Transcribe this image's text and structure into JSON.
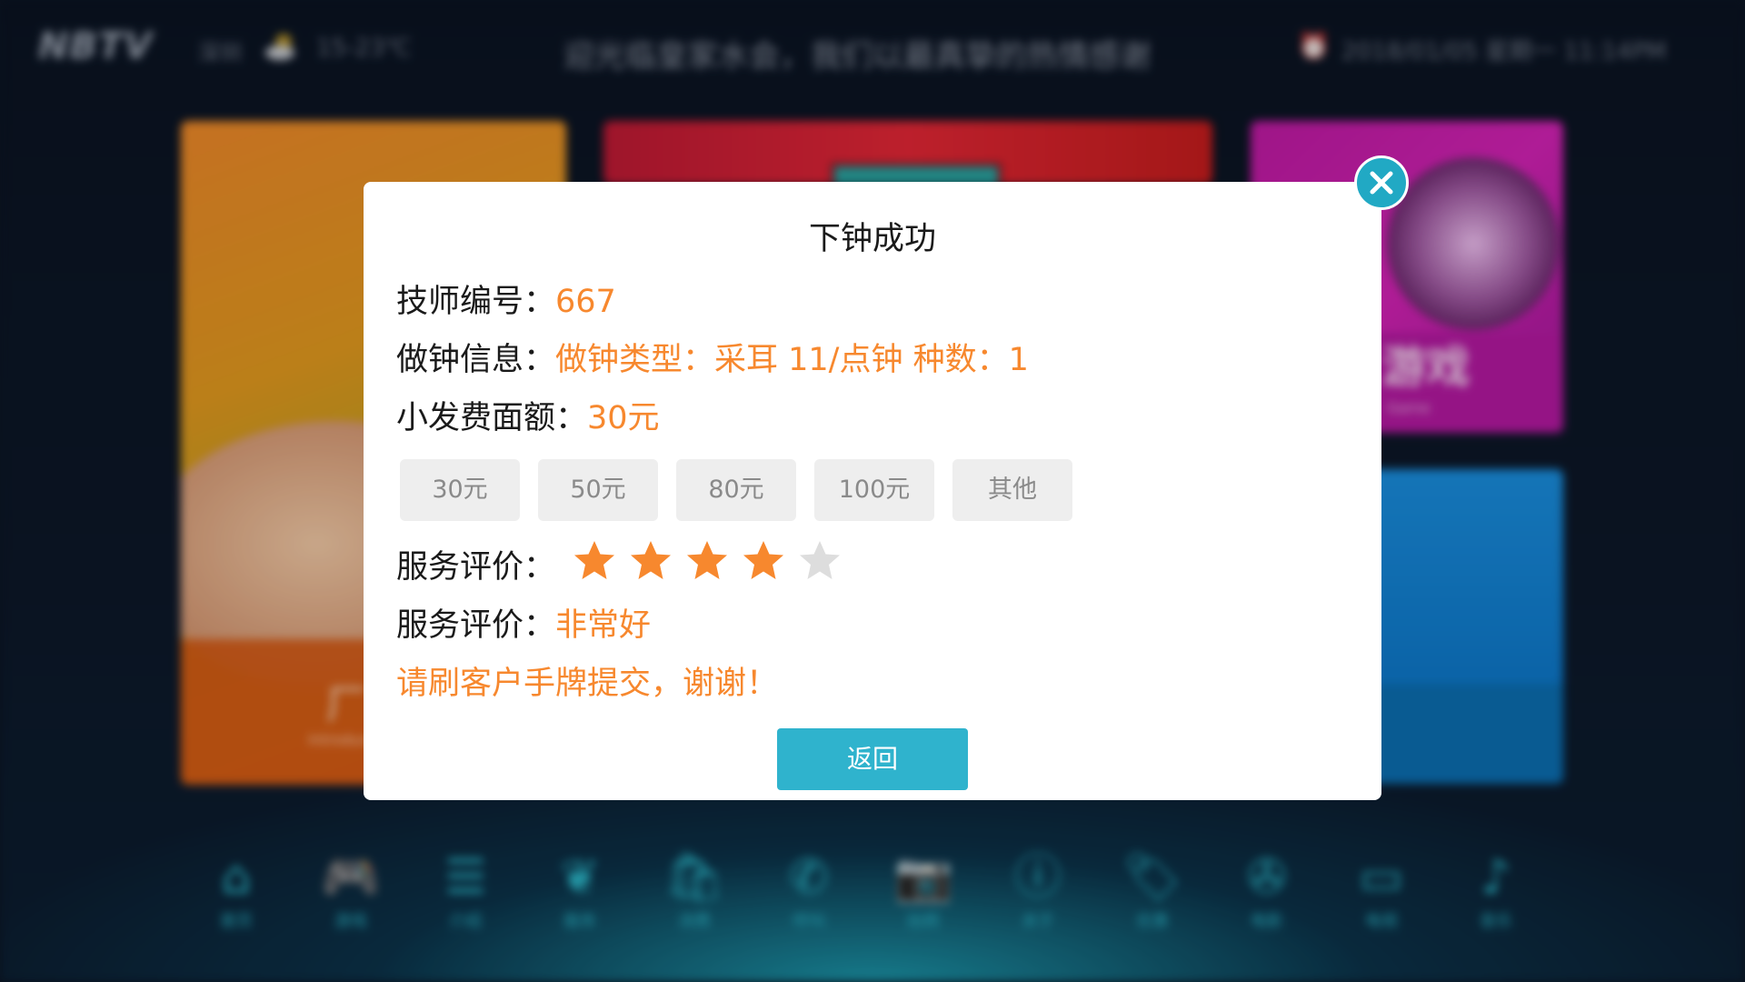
{
  "background": {
    "logo": "NBTV",
    "city": "深圳",
    "weather_icon": "cloud-sun-icon",
    "temperature": "15-23℃",
    "marquee": "迎光临皇家水会，我们以最真挚的热情感谢",
    "alarm_icon": "alarm-clock-icon",
    "datetime": "2018/01/05 星期一 11:14PM",
    "tiles": {
      "left_label": "厂",
      "left_sub": "Introduction",
      "right_top_label": "游戏",
      "right_top_sub": "Game"
    },
    "nav": [
      {
        "icon": "home-icon",
        "glyph": "⌂",
        "label": "首页"
      },
      {
        "icon": "gamepad-icon",
        "glyph": "🎮",
        "label": "游戏"
      },
      {
        "icon": "list-icon",
        "glyph": "☰",
        "label": "介绍"
      },
      {
        "icon": "heart-hand-icon",
        "glyph": "❦",
        "label": "服务"
      },
      {
        "icon": "shopping-bag-icon",
        "glyph": "🛍",
        "label": "消费"
      },
      {
        "icon": "phone-icon",
        "glyph": "✆",
        "label": "呼叫"
      },
      {
        "icon": "camera-icon",
        "glyph": "📷",
        "label": "拍照"
      },
      {
        "icon": "info-icon",
        "glyph": "ⓘ",
        "label": "关于"
      },
      {
        "icon": "tag-icon",
        "glyph": "🏷",
        "label": "优惠"
      },
      {
        "icon": "film-reel-icon",
        "glyph": "✇",
        "label": "电影"
      },
      {
        "icon": "tv-icon",
        "glyph": "▭",
        "label": "电视"
      },
      {
        "icon": "music-note-icon",
        "glyph": "♪",
        "label": "音乐"
      }
    ]
  },
  "dialog": {
    "title": "下钟成功",
    "technician": {
      "label": "技师编号：",
      "value": "667"
    },
    "clock_info": {
      "label": "做钟信息：",
      "value": "做钟类型：采耳 11/点钟 种数：1"
    },
    "tip": {
      "label": "小发费面额：",
      "value": "30元"
    },
    "tip_options": [
      "30元",
      "50元",
      "80元",
      "100元",
      "其他"
    ],
    "rating": {
      "label": "服务评价：",
      "stars_filled": 4,
      "stars_total": 5
    },
    "evaluation": {
      "label": "服务评价：",
      "value": "非常好"
    },
    "notice": "请刷客户手牌提交，谢谢！",
    "back_label": "返回",
    "close_icon": "close-icon",
    "colors": {
      "accent": "#f7882e",
      "primary": "#2fb3cd",
      "star_empty": "#dddddd"
    }
  }
}
